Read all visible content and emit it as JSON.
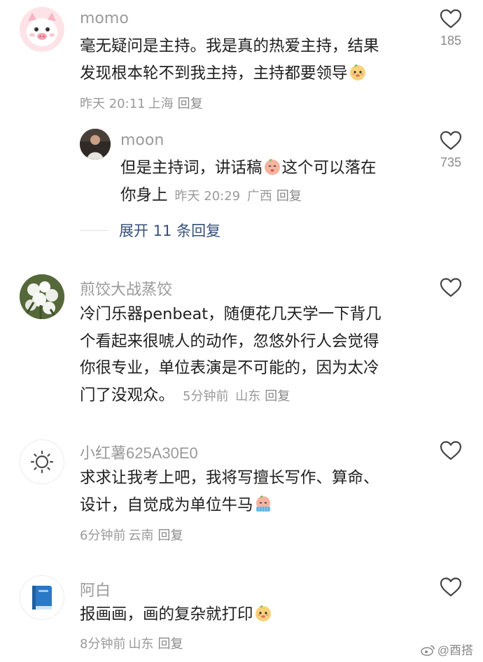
{
  "comments": [
    {
      "username": "momo",
      "lines": [
        "毫无疑问是主持。我是真的热爱主持，结果",
        "发现根本轮不到我主持，主持都要领导"
      ],
      "time": "昨天 20:11",
      "location": "上海",
      "reply_label": "回复",
      "likes": "185",
      "replies": [
        {
          "username": "moon",
          "lines": [
            "但是主持词，讲话稿",
            "这个可以落在",
            "你身上"
          ],
          "time": "昨天 20:29",
          "location": "广西",
          "reply_label": "回复",
          "likes": "735"
        }
      ],
      "expand_label": "展开 11 条回复"
    },
    {
      "username": "煎饺大战蒸饺",
      "lines": [
        "冷门乐器penbeat，随便花几天学一下背几",
        "个看起来很唬人的动作，忽悠外行人会觉得",
        "你很专业，单位表演是不可能的，因为太冷",
        "门了没观众。"
      ],
      "time": "5分钟前",
      "location": "山东",
      "reply_label": "回复"
    },
    {
      "username": "小红薯625A30E0",
      "lines": [
        "求求让我考上吧，我将写擅长写作、算命、",
        "设计，自觉成为单位牛马"
      ],
      "time": "6分钟前",
      "location": "云南",
      "reply_label": "回复"
    },
    {
      "username": "阿白",
      "lines": [
        "报画画，画的复杂就打印"
      ],
      "time": "8分钟前",
      "location": "山东",
      "reply_label": "回复"
    }
  ],
  "watermark": "@酉搭",
  "icons": {
    "like": "heart-outline-icon",
    "emoji": "peach-face-emoji",
    "weibo": "weibo-logo-icon"
  },
  "colors": {
    "text": "#1f1f1f",
    "muted": "#9a9a9a",
    "link": "#36507a"
  }
}
